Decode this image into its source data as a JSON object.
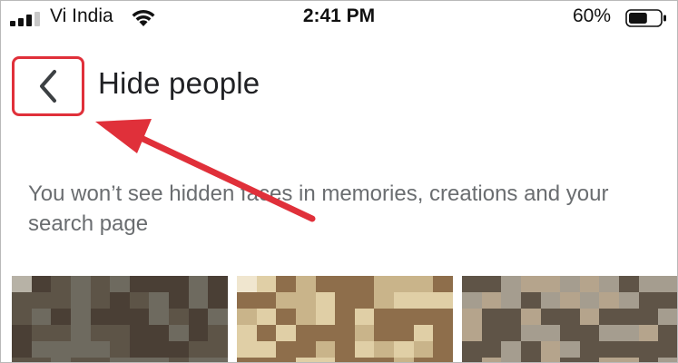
{
  "status_bar": {
    "carrier": "Vi India",
    "time": "2:41 PM",
    "battery_percent": "60%",
    "battery_level": 0.6,
    "signal_bars_active": 3,
    "icons": [
      "signal-icon",
      "wifi-icon",
      "battery-icon"
    ]
  },
  "header": {
    "back_icon": "chevron-left-icon",
    "title": "Hide people"
  },
  "description": "You won’t see hidden faces in memories, creations and your search page",
  "colors": {
    "highlight": "#e0303a",
    "title": "#202124",
    "description": "#6a6d70"
  },
  "faces": {
    "count": 3,
    "palettes": [
      [
        "#6e6a5f",
        "#8b8578",
        "#b7b2a6",
        "#d9d5cb",
        "#4a3f35",
        "#2e2620",
        "#a89a86",
        "#c9c3b6",
        "#5d5447",
        "#e8e4db",
        "#7c6f5c",
        "#3b3129"
      ],
      [
        "#c9b48a",
        "#a8915f",
        "#8a7446",
        "#6a5431",
        "#e0cfa6",
        "#4a3a22",
        "#d6b98c",
        "#b39468",
        "#8e6e4b",
        "#f0e6cf",
        "#5b4430",
        "#c4a77a"
      ],
      [
        "#a59d8f",
        "#7d7466",
        "#c7c0b3",
        "#3c3229",
        "#5f5447",
        "#8f8371",
        "#d6cfc2",
        "#2b231c",
        "#b5a48c",
        "#6f6352",
        "#e3ddd2",
        "#4b3f32"
      ]
    ]
  }
}
